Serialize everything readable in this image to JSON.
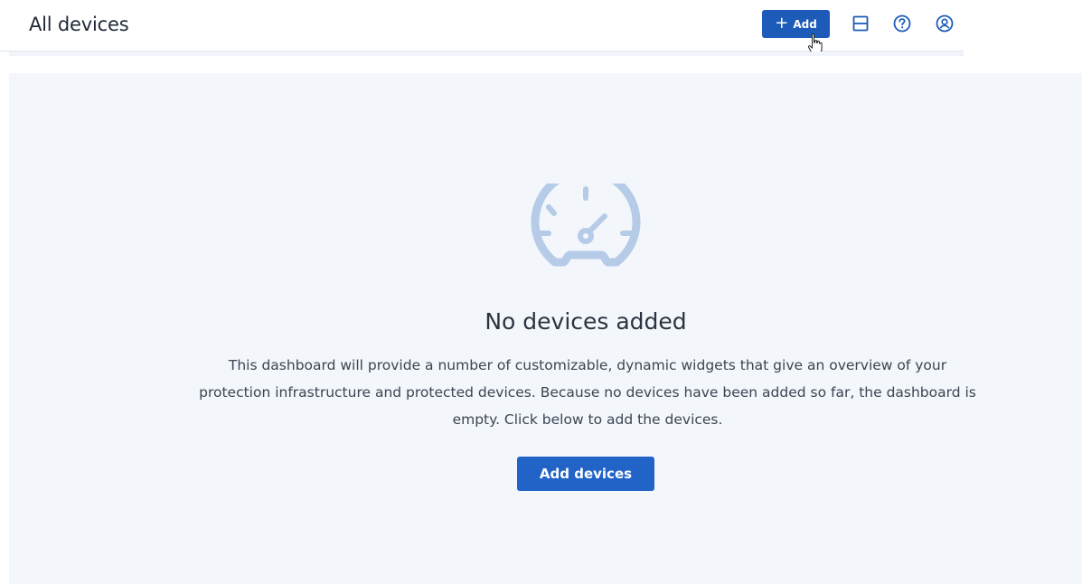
{
  "header": {
    "title": "All devices",
    "add_button": {
      "icon": "plus-icon",
      "label": "Add"
    },
    "icons": [
      "layout-icon",
      "help-icon",
      "account-icon"
    ]
  },
  "empty_state": {
    "icon": "speedometer-icon",
    "title": "No devices added",
    "description": "This dashboard will provide a number of customizable, dynamic widgets that give an overview of your protection infrastructure and protected devices. Because no devices have been added so far, the dashboard is empty. Click below to add the devices.",
    "button_label": "Add devices"
  },
  "colors": {
    "accent": "#1d5bb8",
    "primary_button": "#2163c6",
    "panel_background": "#f3f6fa",
    "empty_icon": "#b5cbe8",
    "header_icon": "#1d5bb8"
  }
}
